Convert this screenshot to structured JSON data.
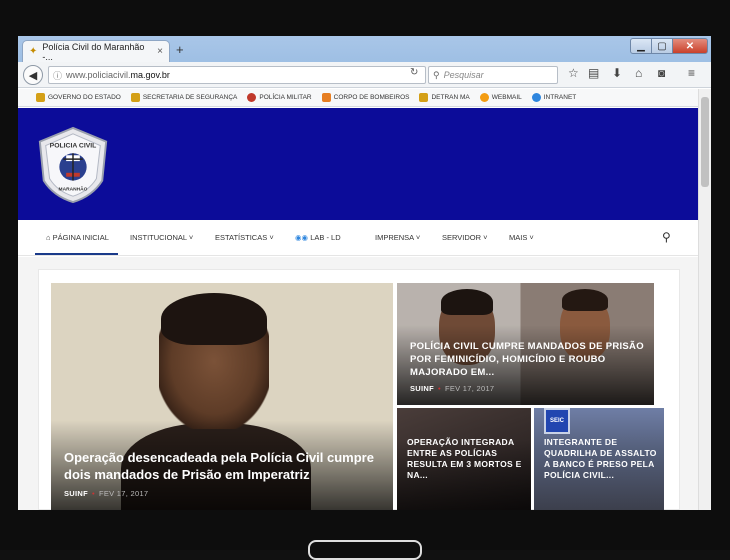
{
  "browser": {
    "tab_title": "Polícia Civil do Maranhão -...",
    "tab_close": "×",
    "new_tab": "+",
    "url_prefix": "www.policiacivil.",
    "url_domain": "ma.gov.br",
    "search_placeholder": "Pesquisar"
  },
  "bookmarks": [
    {
      "label": "GOVERNO DO ESTADO",
      "color": "#d4a017"
    },
    {
      "label": "SECRETARIA DE SEGURANÇA",
      "color": "#d4a017"
    },
    {
      "label": "POLÍCIA MILITAR",
      "color": "#c0392b"
    },
    {
      "label": "CORPO DE BOMBEIROS",
      "color": "#e67e22"
    },
    {
      "label": "DETRAN MA",
      "color": "#d4a017"
    },
    {
      "label": "WEBMAIL",
      "color": "#f39c12"
    },
    {
      "label": "INTRANET",
      "color": "#2e86de"
    }
  ],
  "header": {
    "banner_color": "#0c0c99",
    "badge_text_top": "POLICIA CIVIL",
    "badge_text_bottom": "MARANHÃO"
  },
  "nav": {
    "home": "PÁGINA INICIAL",
    "institucional": "INSTITUCIONAL",
    "estatisticas": "ESTATÍSTICAS",
    "lab": "LAB - LD",
    "imprensa": "IMPRENSA",
    "servidor": "SERVIDOR",
    "mais": "MAIS"
  },
  "featured": {
    "title": "Operação desencadeada pela Polícia Civil cumpre dois mandados de Prisão em Imperatriz",
    "author": "SUINF",
    "date": "FEV 17, 2017"
  },
  "tiles": [
    {
      "title": "POLÍCIA CIVIL CUMPRE MANDADOS DE PRISÃO POR FEMINICÍDIO, HOMICÍDIO E ROUBO MAJORADO EM...",
      "author": "SUINF",
      "date": "FEV 17, 2017"
    },
    {
      "title": "OPERAÇÃO INTEGRADA ENTRE AS POLÍCIAS RESULTA EM 3 MORTOS E NA..."
    },
    {
      "title": "INTEGRANTE DE QUADRILHA DE ASSALTO A BANCO É PRESO PELA POLÍCIA CIVIL..."
    }
  ],
  "tile3_sign": "SEIC"
}
